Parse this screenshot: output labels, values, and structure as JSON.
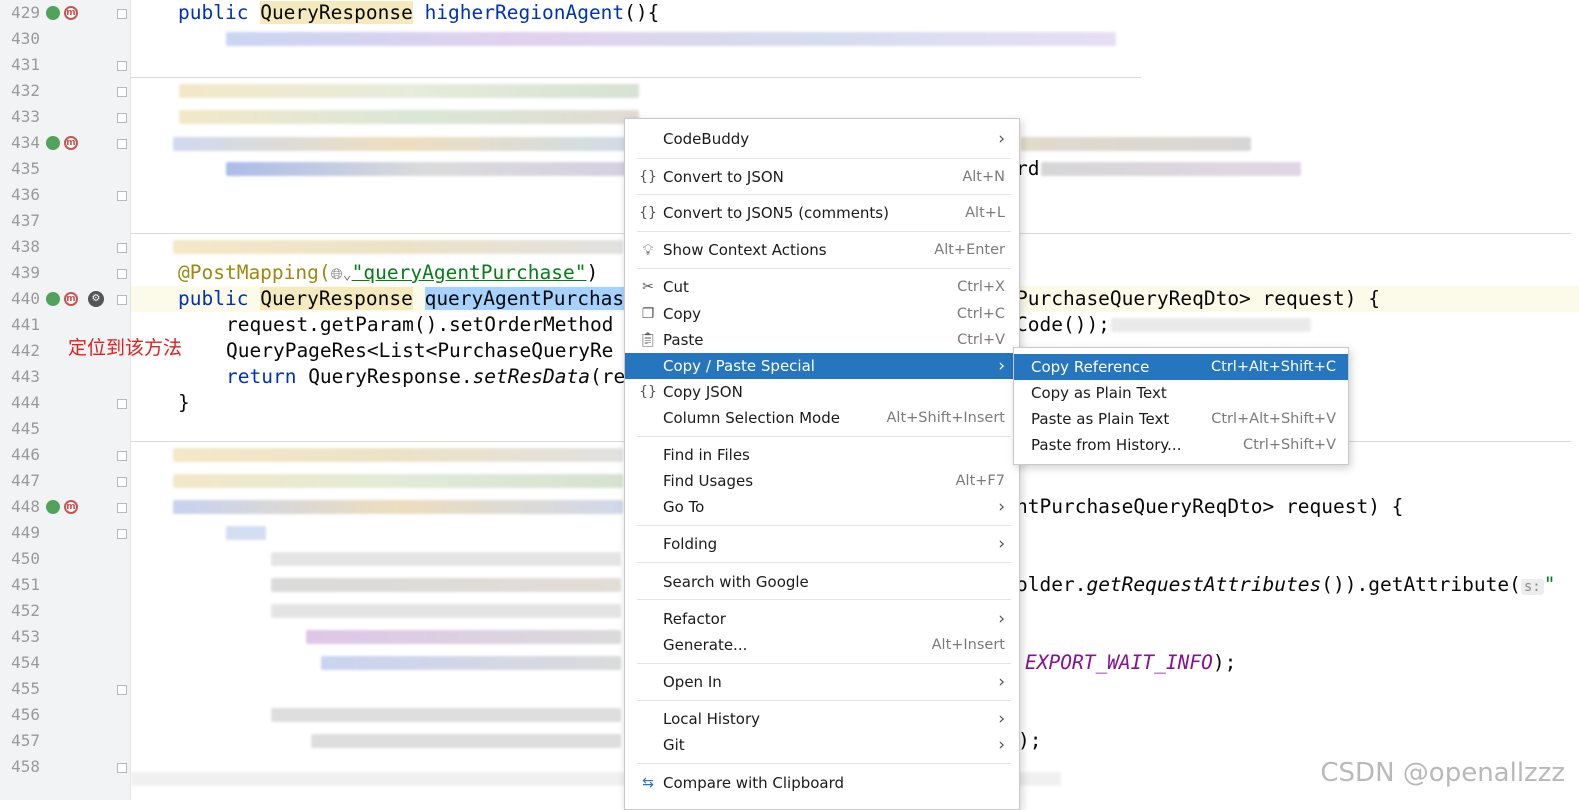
{
  "gutter": {
    "line_numbers": [
      "429",
      "430",
      "431",
      "432",
      "433",
      "434",
      "435",
      "436",
      "437",
      "438",
      "439",
      "440",
      "441",
      "442",
      "443",
      "444",
      "445",
      "446",
      "447",
      "448",
      "449",
      "450",
      "451",
      "452",
      "453",
      "454",
      "455",
      "456",
      "457",
      "458"
    ],
    "annotation": "定位到该方法"
  },
  "code": {
    "line429": {
      "kw": "public",
      "type": "QueryResponse",
      "method": "higherRegionAgent",
      "rest": "(){"
    },
    "line439": {
      "annotation": "@PostMapping(",
      "value": "\"queryAgentPurchase\"",
      "close": ")"
    },
    "line440": {
      "kw": "public",
      "type": "QueryResponse",
      "method": "queryAgentPurchas",
      "tail": "PurchaseQueryReqDto> request) {"
    },
    "line441": {
      "text": "request.getParam().setOrderMethod",
      "tail": "Code());"
    },
    "line442": {
      "text": "QueryPageRes<List<PurchaseQueryRe"
    },
    "line443": {
      "kw": "return",
      "text": " QueryResponse.",
      "ital": "setResData",
      "rest": "(re"
    },
    "line444": {
      "text": "}"
    },
    "line435_tail": "rd",
    "line448_tail": "ntPurchaseQueryReqDto> request) {",
    "line451_tail": {
      "pre": "older.",
      "ital": "getRequestAttributes",
      "post": "()).getAttribute(",
      "hint": "s:",
      "str": "\""
    },
    "line454_tail": {
      "const": "EXPORT_WAIT_INFO",
      "post": ");"
    },
    "line457_tail": ");"
  },
  "menu": {
    "items": [
      {
        "label": "CodeBuddy",
        "shortcut": "",
        "submenu": true
      },
      {
        "label": "Convert to JSON",
        "shortcut": "Alt+N",
        "icon": "braces"
      },
      {
        "label": "Convert to JSON5 (comments)",
        "shortcut": "Alt+L",
        "icon": "braces"
      },
      {
        "label": "Show Context Actions",
        "shortcut": "Alt+Enter",
        "icon": "bulb"
      },
      {
        "label": "Cut",
        "shortcut": "Ctrl+X",
        "icon": "scissors"
      },
      {
        "label": "Copy",
        "shortcut": "Ctrl+C",
        "icon": "copy"
      },
      {
        "label": "Paste",
        "shortcut": "Ctrl+V",
        "icon": "clipboard"
      },
      {
        "label": "Copy / Paste Special",
        "shortcut": "",
        "submenu": true,
        "highlighted": true
      },
      {
        "label": "Copy JSON",
        "shortcut": "",
        "icon": "braces"
      },
      {
        "label": "Column Selection Mode",
        "shortcut": "Alt+Shift+Insert"
      },
      {
        "label": "Find in Files",
        "shortcut": ""
      },
      {
        "label": "Find Usages",
        "shortcut": "Alt+F7"
      },
      {
        "label": "Go To",
        "shortcut": "",
        "submenu": true
      },
      {
        "label": "Folding",
        "shortcut": "",
        "submenu": true
      },
      {
        "label": "Search with Google",
        "shortcut": ""
      },
      {
        "label": "Refactor",
        "shortcut": "",
        "submenu": true
      },
      {
        "label": "Generate...",
        "shortcut": "Alt+Insert"
      },
      {
        "label": "Open In",
        "shortcut": "",
        "submenu": true
      },
      {
        "label": "Local History",
        "shortcut": "",
        "submenu": true
      },
      {
        "label": "Git",
        "shortcut": "",
        "submenu": true
      },
      {
        "label": "Compare with Clipboard",
        "shortcut": "",
        "icon": "compare"
      }
    ],
    "arrow": "›"
  },
  "submenu": {
    "items": [
      {
        "label": "Copy Reference",
        "shortcut": "Ctrl+Alt+Shift+C",
        "highlighted": true
      },
      {
        "label": "Copy as Plain Text",
        "shortcut": ""
      },
      {
        "label": "Paste as Plain Text",
        "shortcut": "Ctrl+Alt+Shift+V"
      },
      {
        "label": "Paste from History...",
        "shortcut": "Ctrl+Shift+V"
      }
    ]
  },
  "watermark": "CSDN @openallzzz",
  "colors": {
    "highlight": "#2675bf",
    "keyword": "#0033b3",
    "annotation": "#9e880d",
    "string": "#067d17",
    "constant": "#871094"
  }
}
